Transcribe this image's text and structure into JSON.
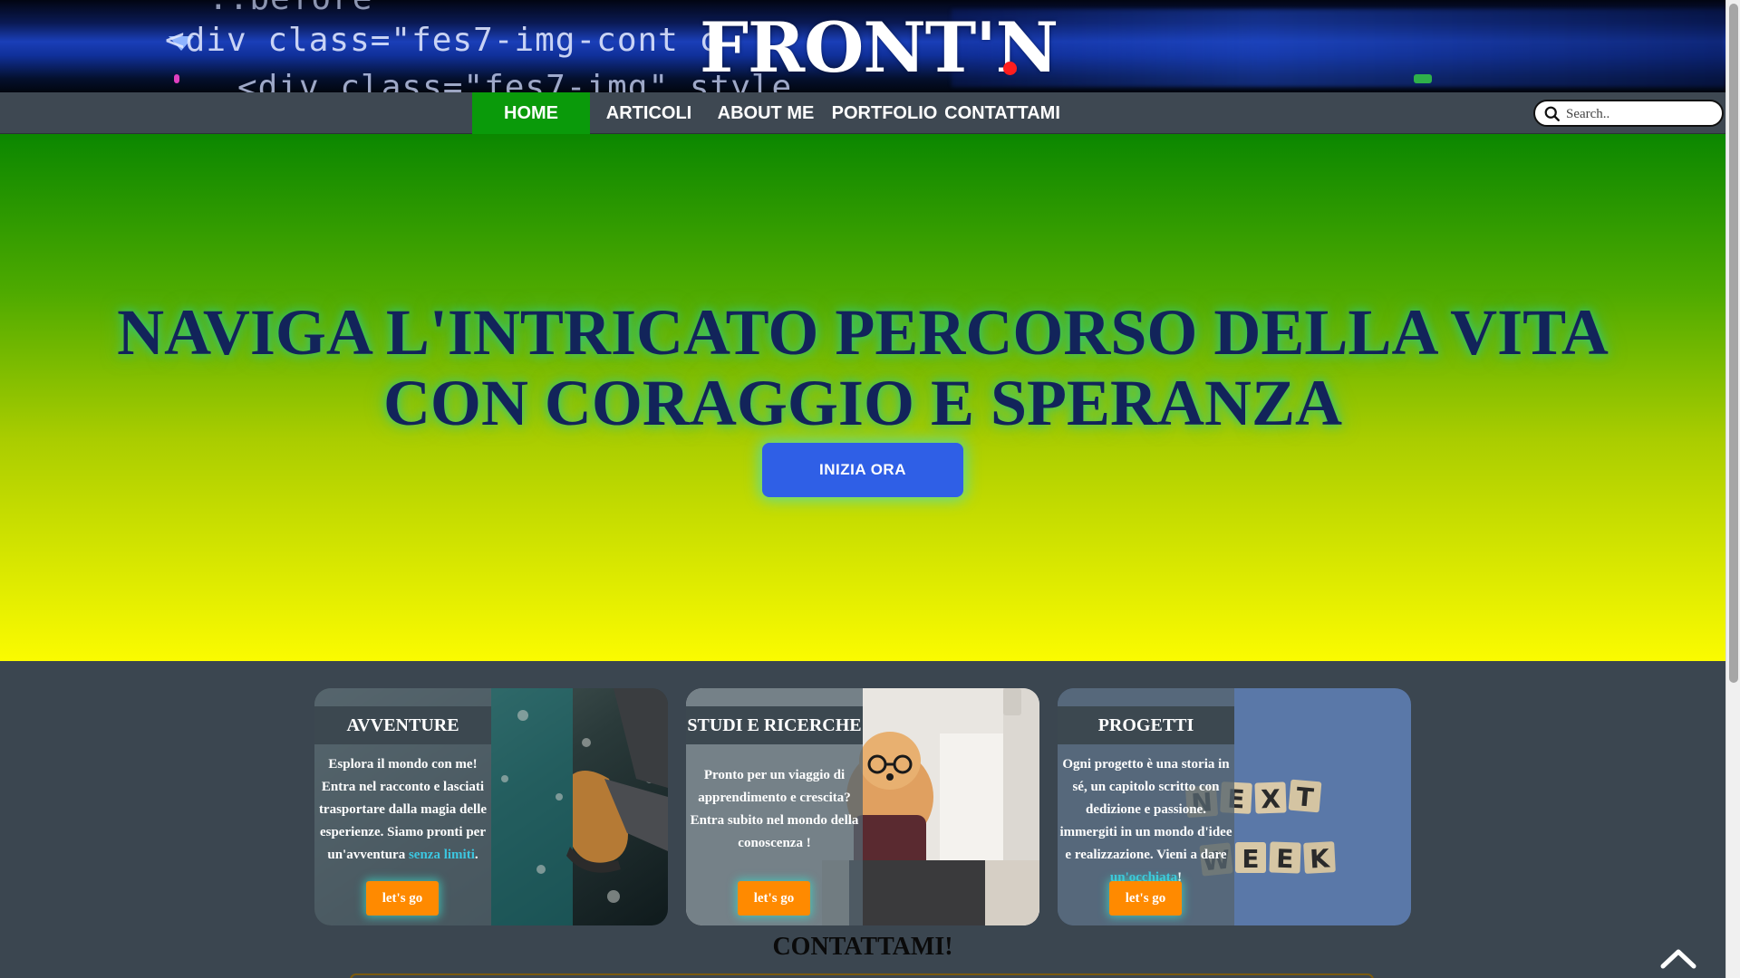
{
  "banner": {
    "code_lines": [
      "::before",
      "<div class=\"fes7-img-cont c",
      "<div class=\"fes7-img\" style"
    ],
    "logo_text": "FRONT'N",
    "logo_dot_color": "#ff1e1e"
  },
  "nav": {
    "items": [
      {
        "label": "HOME",
        "active": true
      },
      {
        "label": "ARTICOLI",
        "active": false
      },
      {
        "label": "ABOUT ME",
        "active": false
      },
      {
        "label": "PORTFOLIO",
        "active": false
      },
      {
        "label": "CONTATTAMI",
        "active": false
      }
    ],
    "search_placeholder": "Search.."
  },
  "hero": {
    "title_line1": "NAVIGA L'INTRICATO PERCORSO DELLA VITA",
    "title_line2": "CON CORAGGIO E SPERANZA",
    "cta_label": "INIZIA ORA"
  },
  "cards": [
    {
      "title": "AVVENTURE",
      "text_before": "Esplora il mondo con me! Entra nel racconto e lasciati trasportare dalla magia delle esperienze. Siamo pronti per un'avventura ",
      "highlight": "senza limiti",
      "text_after": ".",
      "button": "let's go",
      "image": "hiking-boots-on-rocks"
    },
    {
      "title": "STUDI E RICERCHE",
      "text_before": "Pronto per un viaggio di apprendimento e crescita? Entra subito nel mondo della conoscenza !",
      "highlight": "",
      "text_after": "",
      "button": "let's go",
      "image": "dog-with-glasses-at-laptop"
    },
    {
      "title": "PROGETTI",
      "text_before": "Ogni progetto è una storia in sé, un capitolo scritto con dedizione e passione. immergiti in un mondo d'idee e realizzazione. Vieni a dare ",
      "highlight": "un'occhiata",
      "text_after": "!",
      "button": "let's go",
      "image": "next-week-letter-tiles"
    }
  ],
  "contact": {
    "title": "CONTATTAMI!"
  },
  "colors": {
    "nav_active": "#0a9a0a",
    "cta": "#2f5fe6",
    "card_button": "#ff8a00",
    "hero_top": "#0b8700",
    "hero_bottom": "#fbfb00"
  }
}
